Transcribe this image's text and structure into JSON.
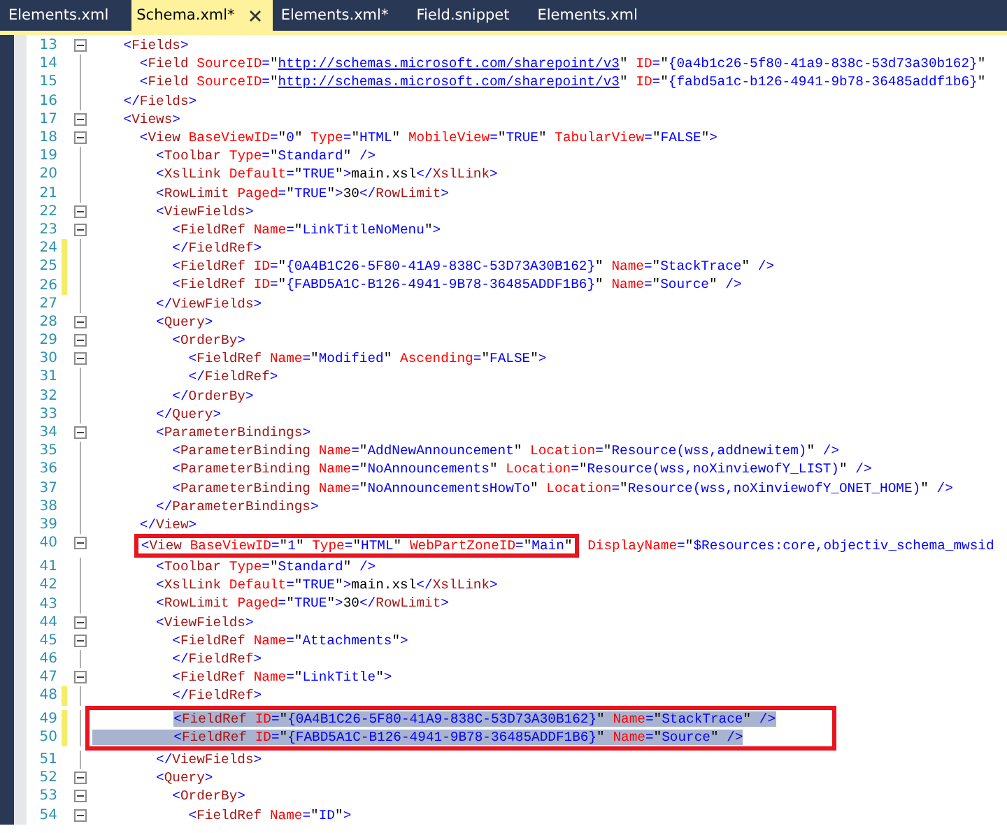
{
  "tabs": [
    {
      "label": "Elements.xml",
      "selected": false
    },
    {
      "label": "Schema.xml*",
      "selected": true
    },
    {
      "label": "Elements.xml*",
      "selected": false
    },
    {
      "label": "Field.snippet",
      "selected": false
    },
    {
      "label": "Elements.xml",
      "selected": false
    }
  ],
  "lines": [
    {
      "number": "13",
      "text": "    <Fields>",
      "foldable": true,
      "changed": false,
      "selected": false,
      "boxed": false
    },
    {
      "number": "14",
      "text": "      <Field SourceID=\"http://schemas.microsoft.com/sharepoint/v3\" ID=\"{0a4b1c26-5f80-41a9-838c-53d73a30b162}\"",
      "foldable": false,
      "changed": false,
      "selected": false,
      "boxed": false
    },
    {
      "number": "15",
      "text": "      <Field SourceID=\"http://schemas.microsoft.com/sharepoint/v3\" ID=\"{fabd5a1c-b126-4941-9b78-36485addf1b6}\"",
      "foldable": false,
      "changed": false,
      "selected": false,
      "boxed": false
    },
    {
      "number": "16",
      "text": "    </Fields>",
      "foldable": false,
      "changed": false,
      "selected": false,
      "boxed": false
    },
    {
      "number": "17",
      "text": "    <Views>",
      "foldable": true,
      "changed": false,
      "selected": false,
      "boxed": false
    },
    {
      "number": "18",
      "text": "      <View BaseViewID=\"0\" Type=\"HTML\" MobileView=\"TRUE\" TabularView=\"FALSE\">",
      "foldable": true,
      "changed": false,
      "selected": false,
      "boxed": false
    },
    {
      "number": "19",
      "text": "        <Toolbar Type=\"Standard\" />",
      "foldable": false,
      "changed": false,
      "selected": false,
      "boxed": false
    },
    {
      "number": "20",
      "text": "        <XslLink Default=\"TRUE\">main.xsl</XslLink>",
      "foldable": false,
      "changed": false,
      "selected": false,
      "boxed": false
    },
    {
      "number": "21",
      "text": "        <RowLimit Paged=\"TRUE\">30</RowLimit>",
      "foldable": false,
      "changed": false,
      "selected": false,
      "boxed": false
    },
    {
      "number": "22",
      "text": "        <ViewFields>",
      "foldable": true,
      "changed": false,
      "selected": false,
      "boxed": false
    },
    {
      "number": "23",
      "text": "          <FieldRef Name=\"LinkTitleNoMenu\">",
      "foldable": true,
      "changed": false,
      "selected": false,
      "boxed": false
    },
    {
      "number": "24",
      "text": "          </FieldRef>",
      "foldable": false,
      "changed": true,
      "selected": false,
      "boxed": false
    },
    {
      "number": "25",
      "text": "          <FieldRef ID=\"{0A4B1C26-5F80-41A9-838C-53D73A30B162}\" Name=\"StackTrace\" />",
      "foldable": false,
      "changed": true,
      "selected": false,
      "boxed": false
    },
    {
      "number": "26",
      "text": "          <FieldRef ID=\"{FABD5A1C-B126-4941-9B78-36485ADDF1B6}\" Name=\"Source\" />",
      "foldable": false,
      "changed": true,
      "selected": false,
      "boxed": false
    },
    {
      "number": "27",
      "text": "        </ViewFields>",
      "foldable": false,
      "changed": false,
      "selected": false,
      "boxed": false
    },
    {
      "number": "28",
      "text": "        <Query>",
      "foldable": true,
      "changed": false,
      "selected": false,
      "boxed": false
    },
    {
      "number": "29",
      "text": "          <OrderBy>",
      "foldable": true,
      "changed": false,
      "selected": false,
      "boxed": false
    },
    {
      "number": "30",
      "text": "            <FieldRef Name=\"Modified\" Ascending=\"FALSE\">",
      "foldable": true,
      "changed": false,
      "selected": false,
      "boxed": false
    },
    {
      "number": "31",
      "text": "            </FieldRef>",
      "foldable": false,
      "changed": false,
      "selected": false,
      "boxed": false
    },
    {
      "number": "32",
      "text": "          </OrderBy>",
      "foldable": false,
      "changed": false,
      "selected": false,
      "boxed": false
    },
    {
      "number": "33",
      "text": "        </Query>",
      "foldable": false,
      "changed": false,
      "selected": false,
      "boxed": false
    },
    {
      "number": "34",
      "text": "        <ParameterBindings>",
      "foldable": true,
      "changed": false,
      "selected": false,
      "boxed": false
    },
    {
      "number": "35",
      "text": "          <ParameterBinding Name=\"AddNewAnnouncement\" Location=\"Resource(wss,addnewitem)\" />",
      "foldable": false,
      "changed": false,
      "selected": false,
      "boxed": false
    },
    {
      "number": "36",
      "text": "          <ParameterBinding Name=\"NoAnnouncements\" Location=\"Resource(wss,noXinviewofY_LIST)\" />",
      "foldable": false,
      "changed": false,
      "selected": false,
      "boxed": false
    },
    {
      "number": "37",
      "text": "          <ParameterBinding Name=\"NoAnnouncementsHowTo\" Location=\"Resource(wss,noXinviewofY_ONET_HOME)\" />",
      "foldable": false,
      "changed": false,
      "selected": false,
      "boxed": false
    },
    {
      "number": "38",
      "text": "        </ParameterBindings>",
      "foldable": false,
      "changed": false,
      "selected": false,
      "boxed": false
    },
    {
      "number": "39",
      "text": "      </View>",
      "foldable": false,
      "changed": false,
      "selected": false,
      "boxed": false
    },
    {
      "number": "40",
      "text": "      <View BaseViewID=\"1\" Type=\"HTML\" WebPartZoneID=\"Main\"",
      "tail": " DisplayName=\"$Resources:core,objectiv_schema_mwsid",
      "foldable": true,
      "changed": false,
      "selected": false,
      "boxed": true
    },
    {
      "number": "41",
      "text": "        <Toolbar Type=\"Standard\" />",
      "foldable": false,
      "changed": false,
      "selected": false,
      "boxed": false
    },
    {
      "number": "42",
      "text": "        <XslLink Default=\"TRUE\">main.xsl</XslLink>",
      "foldable": false,
      "changed": false,
      "selected": false,
      "boxed": false
    },
    {
      "number": "43",
      "text": "        <RowLimit Paged=\"TRUE\">30</RowLimit>",
      "foldable": false,
      "changed": false,
      "selected": false,
      "boxed": false
    },
    {
      "number": "44",
      "text": "        <ViewFields>",
      "foldable": true,
      "changed": false,
      "selected": false,
      "boxed": false
    },
    {
      "number": "45",
      "text": "          <FieldRef Name=\"Attachments\">",
      "foldable": true,
      "changed": false,
      "selected": false,
      "boxed": false
    },
    {
      "number": "46",
      "text": "          </FieldRef>",
      "foldable": false,
      "changed": false,
      "selected": false,
      "boxed": false
    },
    {
      "number": "47",
      "text": "          <FieldRef Name=\"LinkTitle\">",
      "foldable": true,
      "changed": false,
      "selected": false,
      "boxed": false
    },
    {
      "number": "48",
      "text": "          </FieldRef>",
      "foldable": false,
      "changed": true,
      "selected": false,
      "boxed": false
    },
    {
      "number": "49",
      "text": "          <FieldRef ID=\"{0A4B1C26-5F80-41A9-838C-53D73A30B162}\" Name=\"StackTrace\" />",
      "foldable": false,
      "changed": true,
      "selected": true,
      "boxed": true
    },
    {
      "number": "50",
      "text": "          <FieldRef ID=\"{FABD5A1C-B126-4941-9B78-36485ADDF1B6}\" Name=\"Source\" />",
      "foldable": false,
      "changed": true,
      "selected": true,
      "boxed": true
    },
    {
      "number": "51",
      "text": "        </ViewFields>",
      "foldable": false,
      "changed": false,
      "selected": false,
      "boxed": false
    },
    {
      "number": "52",
      "text": "        <Query>",
      "foldable": true,
      "changed": false,
      "selected": false,
      "boxed": false
    },
    {
      "number": "53",
      "text": "          <OrderBy>",
      "foldable": true,
      "changed": false,
      "selected": false,
      "boxed": false
    },
    {
      "number": "54",
      "text": "            <FieldRef Name=\"ID\">",
      "foldable": true,
      "changed": false,
      "selected": false,
      "boxed": false
    }
  ]
}
